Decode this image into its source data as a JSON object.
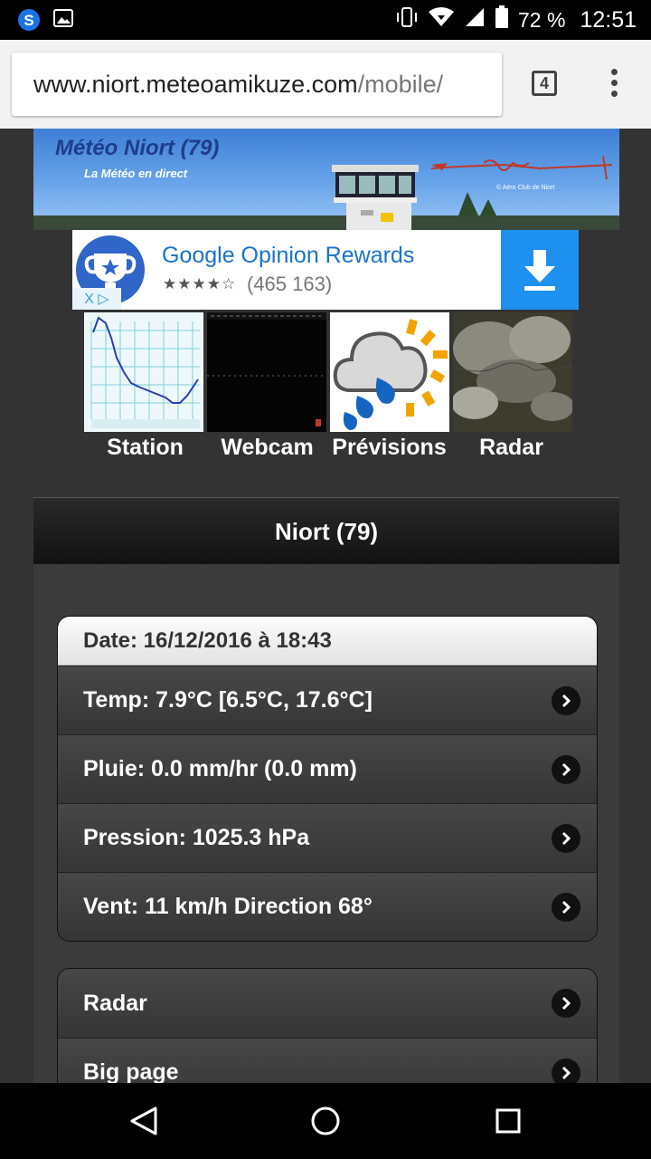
{
  "status_bar": {
    "battery_percent": "72 %",
    "time": "12:51",
    "icons": [
      "app-s-icon",
      "image-notification-icon",
      "vibrate-icon",
      "wifi-icon",
      "signal-icon",
      "battery-icon"
    ]
  },
  "browser": {
    "url_host": "www.niort.meteoamikuze.com",
    "url_path": "/mobile/",
    "tab_count": "4"
  },
  "banner": {
    "title": "Météo Niort (79)",
    "subtitle": "La Météo en direct",
    "credit": "© Aéro Club de Niort"
  },
  "ad": {
    "title": "Google Opinion Rewards",
    "stars": "★★★★☆",
    "rating_count": "(465 163)",
    "ad_choice_label": "X ▷"
  },
  "thumbnails": [
    {
      "label": "Station",
      "icon": "temperature-graph-thumbnail"
    },
    {
      "label": "Webcam",
      "icon": "webcam-night-thumbnail"
    },
    {
      "label": "Prévisions",
      "icon": "rain-cloud-sun-icon"
    },
    {
      "label": "Radar",
      "icon": "satellite-map-thumbnail"
    }
  ],
  "header": {
    "title": "Niort (79)"
  },
  "weather": {
    "date": "Date: 16/12/2016 à 18:43",
    "items": [
      {
        "label": "Temp: 7.9°C [6.5°C, 17.6°C]"
      },
      {
        "label": "Pluie: 0.0 mm/hr (0.0 mm)"
      },
      {
        "label": "Pression: 1025.3 hPa"
      },
      {
        "label": "Vent: 11 km/h Direction 68°"
      }
    ]
  },
  "links": {
    "items": [
      {
        "label": "Radar"
      },
      {
        "label": "Big page"
      }
    ]
  },
  "colors": {
    "accent": "#1e90f0",
    "page_bg": "#333333",
    "ad_title": "#1a73c8"
  }
}
